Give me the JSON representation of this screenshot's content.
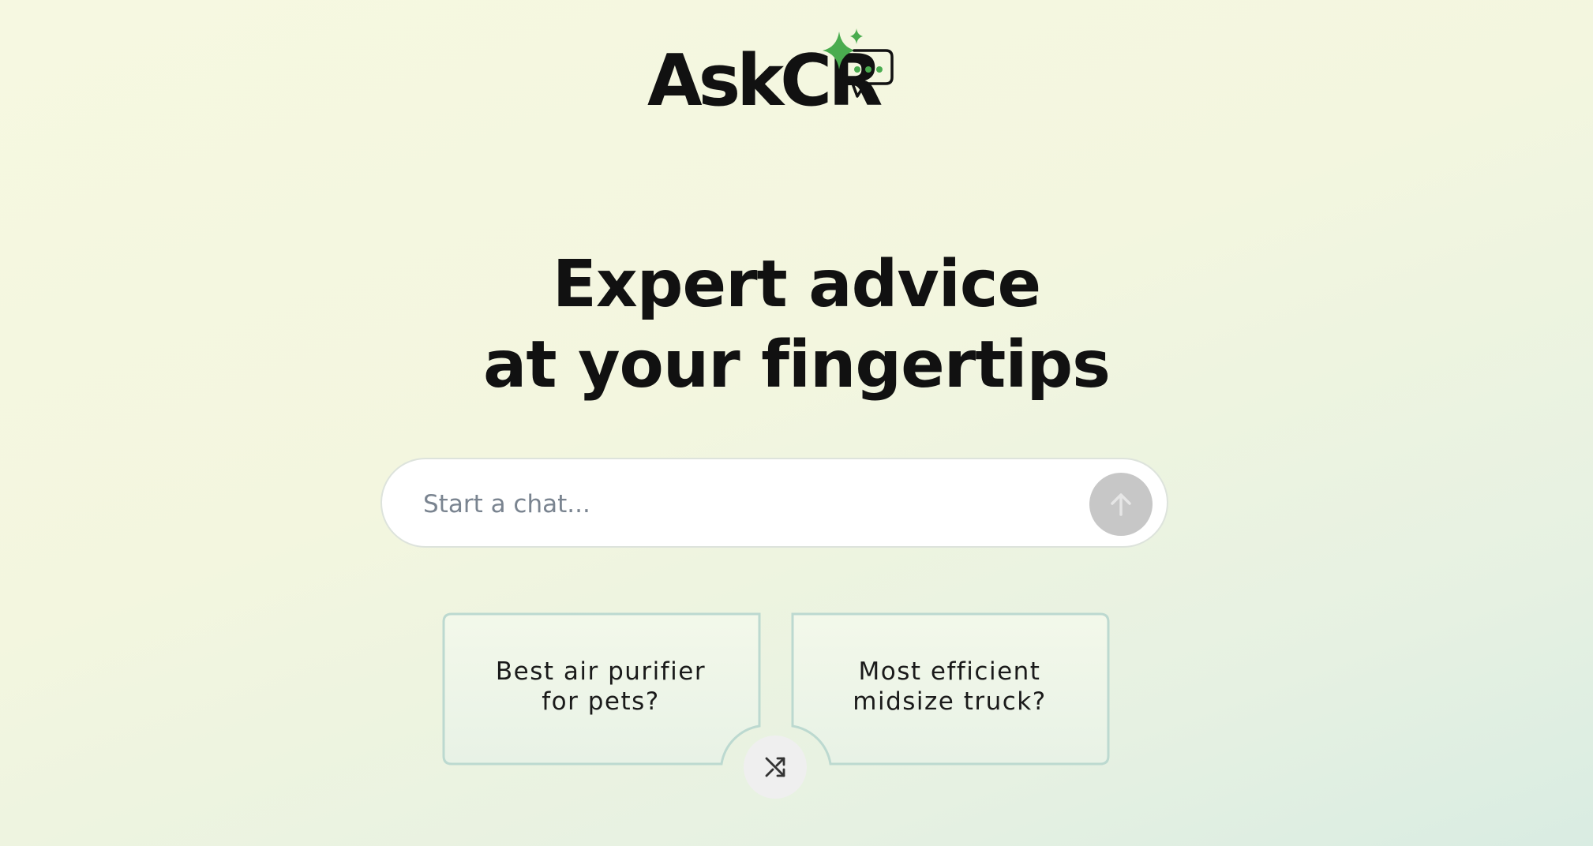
{
  "logo": {
    "text": "AskCR",
    "icon": "sparkle-chat-bubble-icon"
  },
  "headline": {
    "line1": "Expert advice",
    "line2": "at your fingertips"
  },
  "chat": {
    "placeholder": "Start a chat...",
    "send_icon": "arrow-up-icon"
  },
  "suggestions": [
    {
      "line1": "Best air purifier",
      "line2": "for pets?"
    },
    {
      "line1": "Most efficient",
      "line2": "midsize truck?"
    }
  ],
  "shuffle_icon": "shuffle-icon",
  "colors": {
    "accent_green": "#4aac4f",
    "send_button": "#c7c7c7",
    "card_border": "#bcd9d0",
    "background_top": "#f6f8e1",
    "background_bottom": "#d9ece2"
  }
}
